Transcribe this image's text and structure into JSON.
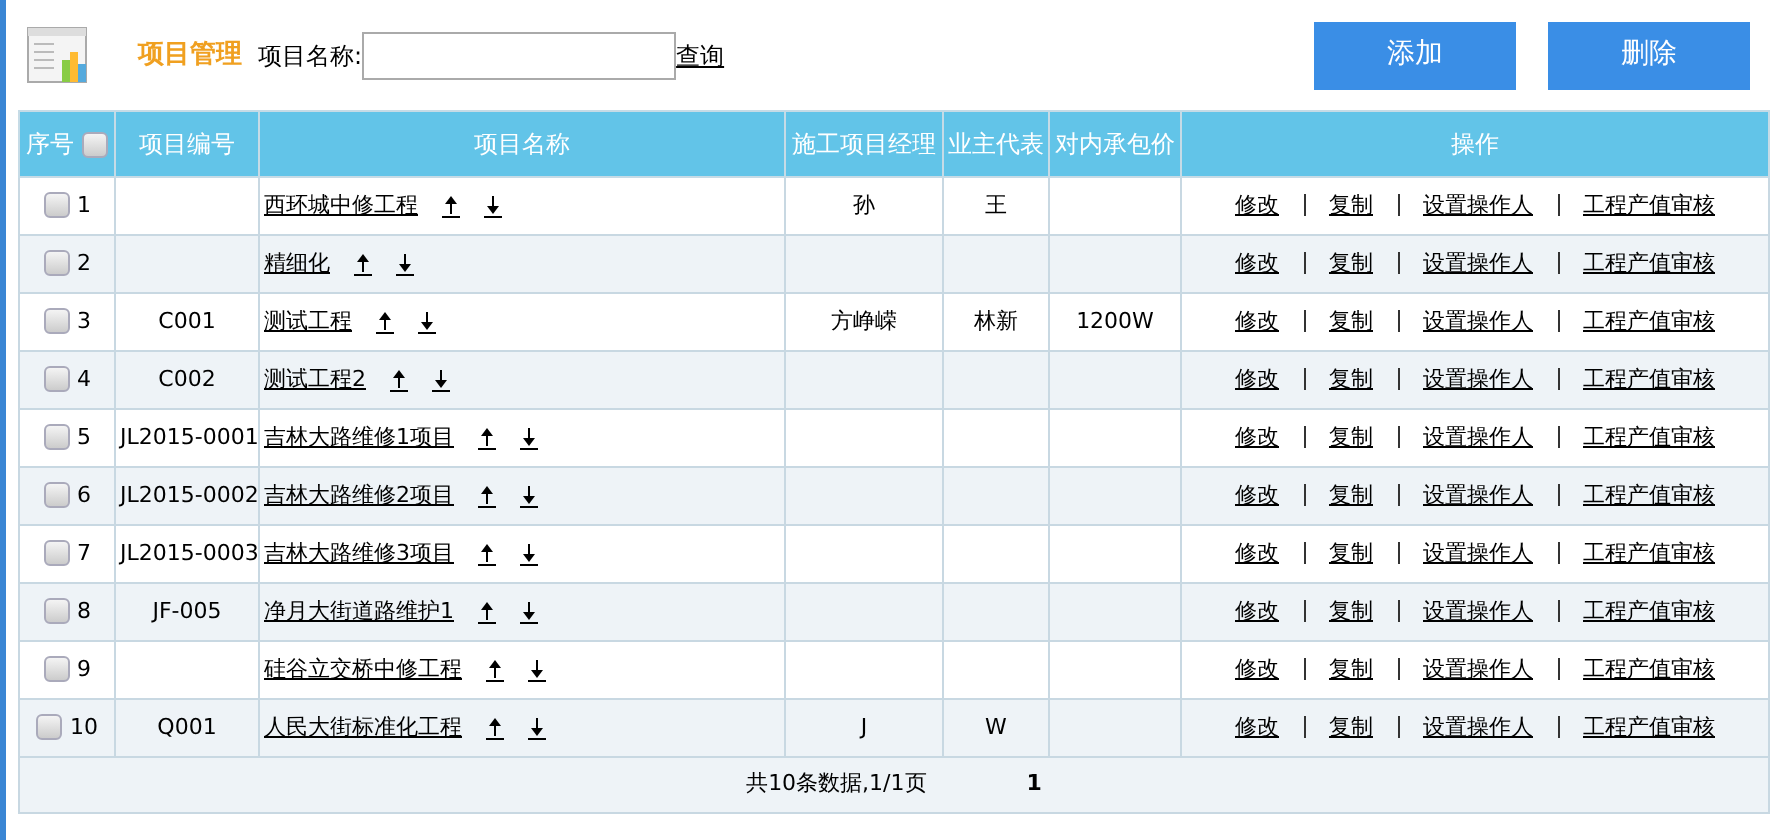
{
  "toolbar": {
    "title": "项目管理",
    "search_label": "项目名称:",
    "search_link": "查询",
    "buttons": [
      "添加",
      "删除"
    ]
  },
  "table": {
    "columns": [
      "序号",
      "项目编号",
      "项目名称",
      "施工项目经理",
      "业主代表",
      "对内承包价",
      "操作"
    ],
    "select_all_checked": false,
    "rows": [
      {
        "checked": false,
        "index": "1",
        "name": "西环城中修工程",
        "manager": "孙",
        "owner_rep": "王",
        "actions": [
          "修改",
          "复制",
          "设置操作人",
          "工程产值审核"
        ]
      },
      {
        "checked": false,
        "index": "2",
        "name": "精细化",
        "actions": [
          "修改",
          "复制",
          "设置操作人",
          "工程产值审核"
        ]
      },
      {
        "checked": false,
        "index": "3",
        "code": "C001",
        "name": "测试工程",
        "manager": "方峥嵘",
        "owner_rep": "林新",
        "price": "1200W",
        "actions": [
          "修改",
          "复制",
          "设置操作人",
          "工程产值审核"
        ]
      },
      {
        "checked": false,
        "index": "4",
        "code": "C002",
        "name": "测试工程2",
        "actions": [
          "修改",
          "复制",
          "设置操作人",
          "工程产值审核"
        ]
      },
      {
        "checked": false,
        "index": "5",
        "code": "JL2015-0001",
        "name": "吉林大路维修1项目",
        "actions": [
          "修改",
          "复制",
          "设置操作人",
          "工程产值审核"
        ]
      },
      {
        "checked": false,
        "index": "6",
        "code": "JL2015-0002",
        "name": "吉林大路维修2项目",
        "actions": [
          "修改",
          "复制",
          "设置操作人",
          "工程产值审核"
        ]
      },
      {
        "checked": false,
        "index": "7",
        "code": "JL2015-0003",
        "name": "吉林大路维修3项目",
        "actions": [
          "修改",
          "复制",
          "设置操作人",
          "工程产值审核"
        ]
      },
      {
        "checked": false,
        "index": "8",
        "code": "JF-005",
        "name": "净月大街道路维护1",
        "actions": [
          "修改",
          "复制",
          "设置操作人",
          "工程产值审核"
        ]
      },
      {
        "checked": false,
        "index": "9",
        "name": "硅谷立交桥中修工程",
        "actions": [
          "修改",
          "复制",
          "设置操作人",
          "工程产值审核"
        ]
      },
      {
        "checked": false,
        "index": "10",
        "code": "Q001",
        "name": "人民大街标准化工程",
        "manager": "J",
        "owner_rep": "W",
        "actions": [
          "修改",
          "复制",
          "设置操作人",
          "工程产值审核"
        ]
      }
    ]
  },
  "pager": {
    "summary": "共10条数据,1/1页",
    "pages": [
      {
        "label": "1",
        "selected": true
      }
    ]
  }
}
